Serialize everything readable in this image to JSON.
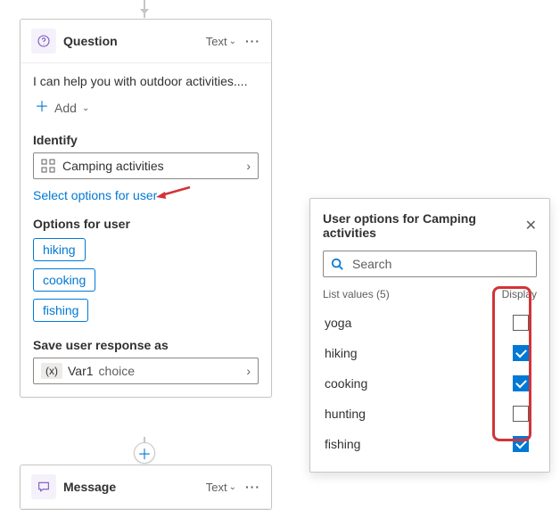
{
  "question_card": {
    "title": "Question",
    "type_label": "Text",
    "description": "I can help you with outdoor activities....",
    "add_label": "Add",
    "identify_label": "Identify",
    "identify_value": "Camping activities",
    "select_options_link": "Select options for user",
    "options_label": "Options for user",
    "options": [
      "hiking",
      "cooking",
      "fishing"
    ],
    "save_label": "Save user response as",
    "variable": {
      "badge": "(x)",
      "name": "Var1",
      "type": "choice"
    }
  },
  "message_card": {
    "title": "Message",
    "type_label": "Text"
  },
  "popup": {
    "title": "User options for Camping activities",
    "search_placeholder": "Search",
    "list_count_label": "List values (5)",
    "display_label": "Display",
    "items": [
      {
        "label": "yoga",
        "checked": false
      },
      {
        "label": "hiking",
        "checked": true
      },
      {
        "label": "cooking",
        "checked": true
      },
      {
        "label": "hunting",
        "checked": false
      },
      {
        "label": "fishing",
        "checked": true
      }
    ]
  }
}
